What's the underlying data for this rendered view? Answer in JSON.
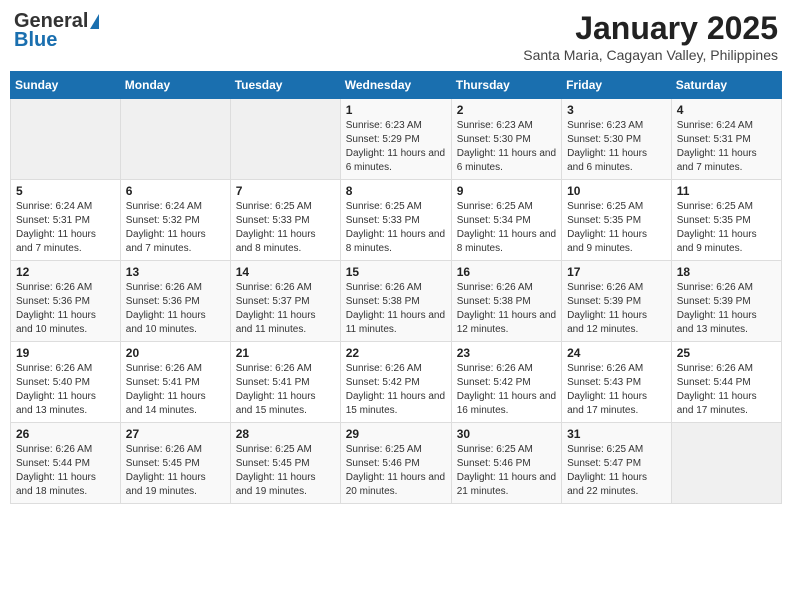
{
  "header": {
    "logo_general": "General",
    "logo_blue": "Blue",
    "month_title": "January 2025",
    "location": "Santa Maria, Cagayan Valley, Philippines"
  },
  "weekdays": [
    "Sunday",
    "Monday",
    "Tuesday",
    "Wednesday",
    "Thursday",
    "Friday",
    "Saturday"
  ],
  "weeks": [
    [
      {
        "day": "",
        "sunrise": "",
        "sunset": "",
        "daylight": ""
      },
      {
        "day": "",
        "sunrise": "",
        "sunset": "",
        "daylight": ""
      },
      {
        "day": "",
        "sunrise": "",
        "sunset": "",
        "daylight": ""
      },
      {
        "day": "1",
        "sunrise": "Sunrise: 6:23 AM",
        "sunset": "Sunset: 5:29 PM",
        "daylight": "Daylight: 11 hours and 6 minutes."
      },
      {
        "day": "2",
        "sunrise": "Sunrise: 6:23 AM",
        "sunset": "Sunset: 5:30 PM",
        "daylight": "Daylight: 11 hours and 6 minutes."
      },
      {
        "day": "3",
        "sunrise": "Sunrise: 6:23 AM",
        "sunset": "Sunset: 5:30 PM",
        "daylight": "Daylight: 11 hours and 6 minutes."
      },
      {
        "day": "4",
        "sunrise": "Sunrise: 6:24 AM",
        "sunset": "Sunset: 5:31 PM",
        "daylight": "Daylight: 11 hours and 7 minutes."
      }
    ],
    [
      {
        "day": "5",
        "sunrise": "Sunrise: 6:24 AM",
        "sunset": "Sunset: 5:31 PM",
        "daylight": "Daylight: 11 hours and 7 minutes."
      },
      {
        "day": "6",
        "sunrise": "Sunrise: 6:24 AM",
        "sunset": "Sunset: 5:32 PM",
        "daylight": "Daylight: 11 hours and 7 minutes."
      },
      {
        "day": "7",
        "sunrise": "Sunrise: 6:25 AM",
        "sunset": "Sunset: 5:33 PM",
        "daylight": "Daylight: 11 hours and 8 minutes."
      },
      {
        "day": "8",
        "sunrise": "Sunrise: 6:25 AM",
        "sunset": "Sunset: 5:33 PM",
        "daylight": "Daylight: 11 hours and 8 minutes."
      },
      {
        "day": "9",
        "sunrise": "Sunrise: 6:25 AM",
        "sunset": "Sunset: 5:34 PM",
        "daylight": "Daylight: 11 hours and 8 minutes."
      },
      {
        "day": "10",
        "sunrise": "Sunrise: 6:25 AM",
        "sunset": "Sunset: 5:35 PM",
        "daylight": "Daylight: 11 hours and 9 minutes."
      },
      {
        "day": "11",
        "sunrise": "Sunrise: 6:25 AM",
        "sunset": "Sunset: 5:35 PM",
        "daylight": "Daylight: 11 hours and 9 minutes."
      }
    ],
    [
      {
        "day": "12",
        "sunrise": "Sunrise: 6:26 AM",
        "sunset": "Sunset: 5:36 PM",
        "daylight": "Daylight: 11 hours and 10 minutes."
      },
      {
        "day": "13",
        "sunrise": "Sunrise: 6:26 AM",
        "sunset": "Sunset: 5:36 PM",
        "daylight": "Daylight: 11 hours and 10 minutes."
      },
      {
        "day": "14",
        "sunrise": "Sunrise: 6:26 AM",
        "sunset": "Sunset: 5:37 PM",
        "daylight": "Daylight: 11 hours and 11 minutes."
      },
      {
        "day": "15",
        "sunrise": "Sunrise: 6:26 AM",
        "sunset": "Sunset: 5:38 PM",
        "daylight": "Daylight: 11 hours and 11 minutes."
      },
      {
        "day": "16",
        "sunrise": "Sunrise: 6:26 AM",
        "sunset": "Sunset: 5:38 PM",
        "daylight": "Daylight: 11 hours and 12 minutes."
      },
      {
        "day": "17",
        "sunrise": "Sunrise: 6:26 AM",
        "sunset": "Sunset: 5:39 PM",
        "daylight": "Daylight: 11 hours and 12 minutes."
      },
      {
        "day": "18",
        "sunrise": "Sunrise: 6:26 AM",
        "sunset": "Sunset: 5:39 PM",
        "daylight": "Daylight: 11 hours and 13 minutes."
      }
    ],
    [
      {
        "day": "19",
        "sunrise": "Sunrise: 6:26 AM",
        "sunset": "Sunset: 5:40 PM",
        "daylight": "Daylight: 11 hours and 13 minutes."
      },
      {
        "day": "20",
        "sunrise": "Sunrise: 6:26 AM",
        "sunset": "Sunset: 5:41 PM",
        "daylight": "Daylight: 11 hours and 14 minutes."
      },
      {
        "day": "21",
        "sunrise": "Sunrise: 6:26 AM",
        "sunset": "Sunset: 5:41 PM",
        "daylight": "Daylight: 11 hours and 15 minutes."
      },
      {
        "day": "22",
        "sunrise": "Sunrise: 6:26 AM",
        "sunset": "Sunset: 5:42 PM",
        "daylight": "Daylight: 11 hours and 15 minutes."
      },
      {
        "day": "23",
        "sunrise": "Sunrise: 6:26 AM",
        "sunset": "Sunset: 5:42 PM",
        "daylight": "Daylight: 11 hours and 16 minutes."
      },
      {
        "day": "24",
        "sunrise": "Sunrise: 6:26 AM",
        "sunset": "Sunset: 5:43 PM",
        "daylight": "Daylight: 11 hours and 17 minutes."
      },
      {
        "day": "25",
        "sunrise": "Sunrise: 6:26 AM",
        "sunset": "Sunset: 5:44 PM",
        "daylight": "Daylight: 11 hours and 17 minutes."
      }
    ],
    [
      {
        "day": "26",
        "sunrise": "Sunrise: 6:26 AM",
        "sunset": "Sunset: 5:44 PM",
        "daylight": "Daylight: 11 hours and 18 minutes."
      },
      {
        "day": "27",
        "sunrise": "Sunrise: 6:26 AM",
        "sunset": "Sunset: 5:45 PM",
        "daylight": "Daylight: 11 hours and 19 minutes."
      },
      {
        "day": "28",
        "sunrise": "Sunrise: 6:25 AM",
        "sunset": "Sunset: 5:45 PM",
        "daylight": "Daylight: 11 hours and 19 minutes."
      },
      {
        "day": "29",
        "sunrise": "Sunrise: 6:25 AM",
        "sunset": "Sunset: 5:46 PM",
        "daylight": "Daylight: 11 hours and 20 minutes."
      },
      {
        "day": "30",
        "sunrise": "Sunrise: 6:25 AM",
        "sunset": "Sunset: 5:46 PM",
        "daylight": "Daylight: 11 hours and 21 minutes."
      },
      {
        "day": "31",
        "sunrise": "Sunrise: 6:25 AM",
        "sunset": "Sunset: 5:47 PM",
        "daylight": "Daylight: 11 hours and 22 minutes."
      },
      {
        "day": "",
        "sunrise": "",
        "sunset": "",
        "daylight": ""
      }
    ]
  ]
}
